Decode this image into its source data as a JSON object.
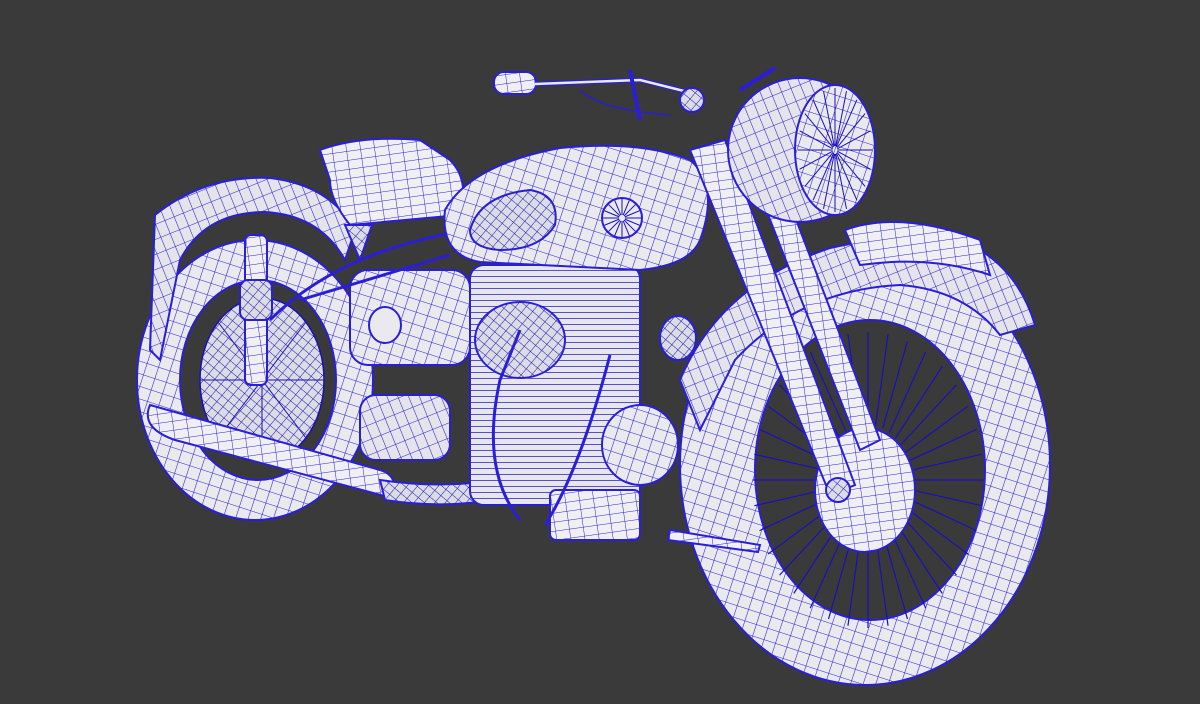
{
  "scene": {
    "subject": "motorcycle-wireframe-render",
    "colors": {
      "background": "#3a3a3a",
      "surface": "#e9e9ee",
      "surface_shade": "#c9c9d2",
      "wire": "#2a1fd6",
      "wire_dense": "#1b10b8"
    }
  }
}
